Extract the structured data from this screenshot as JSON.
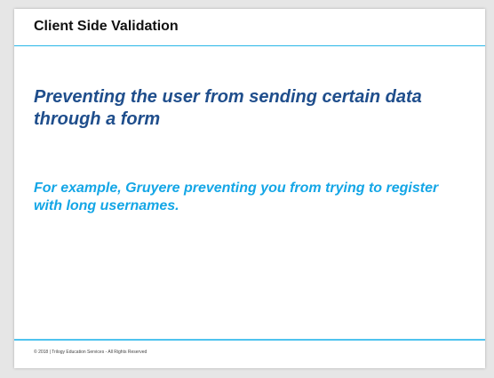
{
  "slide": {
    "title": "Client Side Validation",
    "heading": "Preventing the user from sending certain data through a form",
    "example": "For example, Gruyere preventing you from trying to register with long usernames.",
    "footer": "© 2018 | Trilogy Education Services - All Rights Reserved"
  },
  "colors": {
    "heading": "#1f4e8c",
    "example": "#14a6e6",
    "rule": "#29b6e8"
  }
}
